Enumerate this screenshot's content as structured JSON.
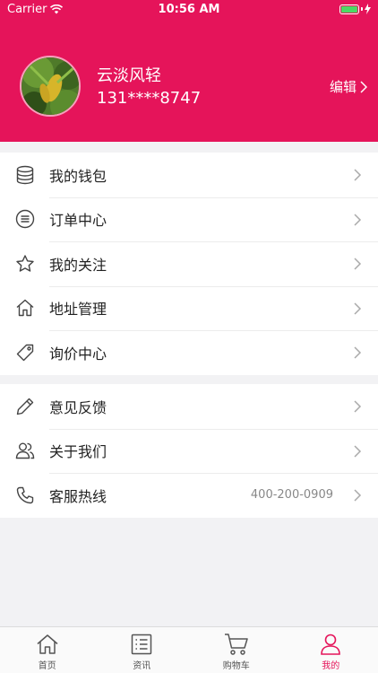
{
  "status_bar": {
    "carrier": "Carrier",
    "time": "10:56 AM"
  },
  "profile": {
    "name": "云淡风轻",
    "phone": "131****8747",
    "edit_label": "编辑"
  },
  "menu_group_1": [
    {
      "label": "我的钱包",
      "icon": "wallet-database-icon"
    },
    {
      "label": "订单中心",
      "icon": "list-circle-icon"
    },
    {
      "label": "我的关注",
      "icon": "star-icon"
    },
    {
      "label": "地址管理",
      "icon": "home-icon"
    },
    {
      "label": "询价中心",
      "icon": "tag-icon"
    }
  ],
  "menu_group_2": [
    {
      "label": "意见反馈",
      "icon": "pencil-icon"
    },
    {
      "label": "关于我们",
      "icon": "people-icon"
    },
    {
      "label": "客服热线",
      "icon": "phone-icon",
      "value": "400-200-0909"
    }
  ],
  "tab_bar": [
    {
      "label": "首页",
      "icon": "home-icon"
    },
    {
      "label": "资讯",
      "icon": "news-list-icon"
    },
    {
      "label": "购物车",
      "icon": "cart-icon"
    },
    {
      "label": "我的",
      "icon": "person-icon",
      "active": true
    }
  ],
  "colors": {
    "brand": "#e5145a",
    "background": "#f2f2f4",
    "battery": "#4cd964"
  }
}
